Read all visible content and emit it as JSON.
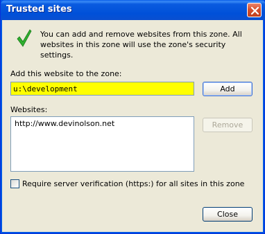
{
  "window": {
    "title": "Trusted sites"
  },
  "info": {
    "icon": "checkmark-icon",
    "text": "You can add and remove websites from this zone. All websites in this zone will use the zone's security settings."
  },
  "add_section": {
    "label": "Add this website to the zone:",
    "input_value": "u:\\development",
    "add_label": "Add",
    "input_highlight_color": "#ffff00"
  },
  "websites_section": {
    "label": "Websites:",
    "items": [
      "http://www.devinolson.net"
    ],
    "remove_label": "Remove"
  },
  "verification": {
    "label": "Require server verification (https:) for all sites in this zone",
    "checked": false
  },
  "footer": {
    "close_label": "Close"
  }
}
